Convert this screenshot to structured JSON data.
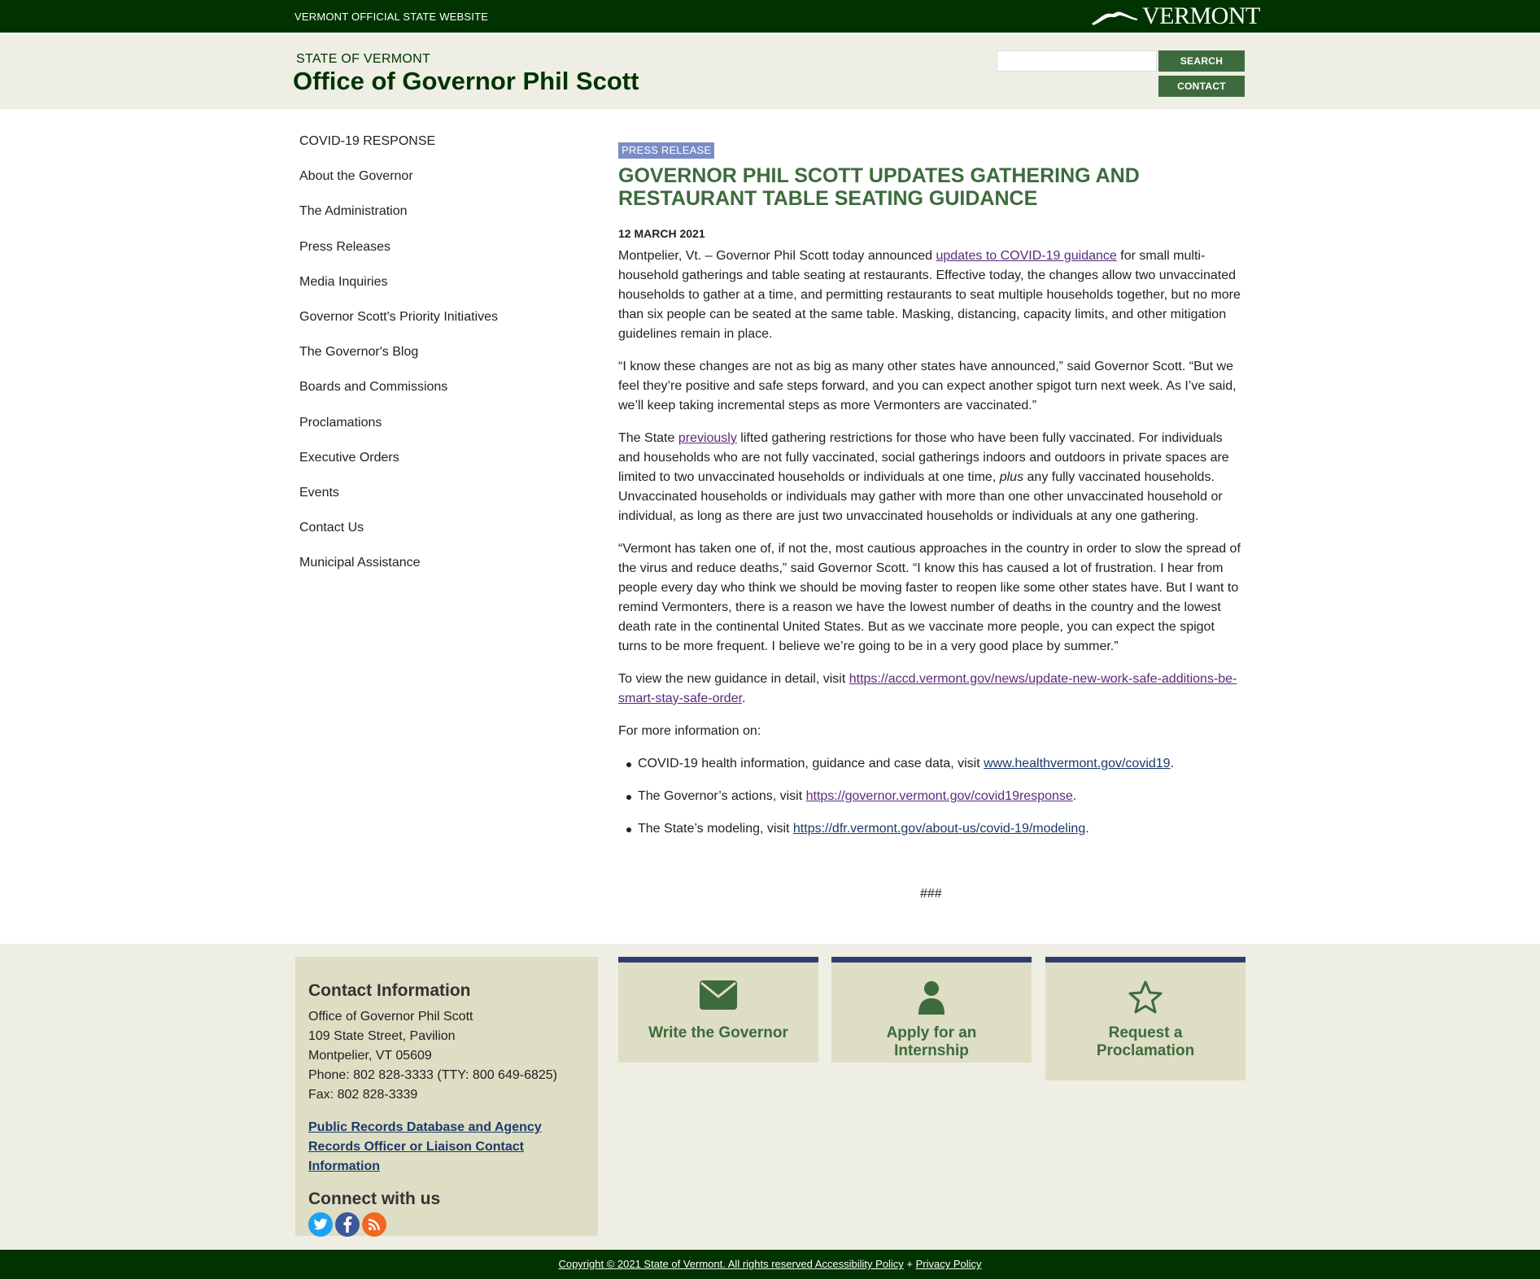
{
  "topbar": {
    "official_label": "VERMONT OFFICIAL STATE WEBSITE",
    "logo_text": "VERMONT"
  },
  "header": {
    "state_label": "STATE OF VERMONT",
    "office_title": "Office of Governor Phil Scott",
    "search_placeholder": "",
    "search_button": "SEARCH",
    "contact_button": "CONTACT"
  },
  "sidebar": {
    "items": [
      "COVID-19 RESPONSE",
      "About the Governor",
      "The Administration",
      "Press Releases",
      "Media Inquiries",
      "Governor Scott's Priority Initiatives",
      "The Governor's Blog",
      "Boards and Commissions",
      "Proclamations",
      "Executive Orders",
      "Events",
      "Contact Us",
      "Municipal Assistance"
    ]
  },
  "article": {
    "badge": "PRESS RELEASE",
    "headline": "GOVERNOR PHIL SCOTT UPDATES GATHERING AND RESTAURANT TABLE SEATING GUIDANCE",
    "date": "12 MARCH 2021",
    "p1_before": "Montpelier, Vt. – Governor Phil Scott today announced ",
    "p1_link": "updates to COVID-19 guidance",
    "p1_after": " for small multi-household gatherings and table seating at restaurants. Effective today, the changes allow two unvaccinated households to gather at a time, and permitting restaurants to seat multiple households together, but no more than six people can be seated at the same table. Masking, distancing, capacity limits, and other mitigation guidelines remain in place.",
    "p2": "“I know these changes are not as big as many other states have announced,” said Governor Scott. “But we feel they’re positive and safe steps forward, and you can expect another spigot turn next week. As I’ve said, we’ll keep taking incremental steps as more Vermonters are vaccinated.”",
    "p3_before": "The State ",
    "p3_link": "previously",
    "p3_mid": " lifted gathering restrictions for those who have been fully vaccinated. For individuals and households who are not fully vaccinated, social gatherings indoors and outdoors in private spaces are limited to two unvaccinated households or individuals at one time, ",
    "p3_em": "plus",
    "p3_after": " any fully vaccinated households. Unvaccinated households or individuals may gather with more than one other unvaccinated household or individual, as long as there are just two unvaccinated households or individuals at any one gathering.",
    "p4": "“Vermont has taken one of, if not the, most cautious approaches in the country in order to slow the spread of the virus and reduce deaths,” said Governor Scott. “I know this has caused a lot of frustration. I hear from people every day who think we should be moving faster to reopen like some other states have. But I want to remind Vermonters, there is a reason we have the lowest number of deaths in the country and the lowest death rate in the continental United States. But as we vaccinate more people, you can expect the spigot turns to be more frequent. I believe we’re going to be in a very good place by summer.”",
    "p5_before": "To view the new guidance in detail, visit ",
    "p5_link": "https://accd.vermont.gov/news/update-new-work-safe-additions-be-smart-stay-safe-order",
    "p5_after": ".",
    "p6": "For more information on:",
    "bullets": [
      {
        "before": "COVID-19 health information, guidance and case data, visit ",
        "link": "www.healthvermont.gov/covid19",
        "after": "."
      },
      {
        "before": "The Governor’s actions, visit ",
        "link": "https://governor.vermont.gov/covid19response",
        "after": "."
      },
      {
        "before": "The State’s modeling, visit ",
        "link": "https://dfr.vermont.gov/about-us/covid-19/modeling",
        "after": "."
      }
    ],
    "end_mark": "###"
  },
  "footer": {
    "contact_title": "Contact Information",
    "lines": [
      "Office of Governor Phil Scott",
      "109 State Street, Pavilion",
      "Montpelier, VT 05609",
      "Phone: 802 828-3333 (TTY: 800 649-6825)",
      "Fax: 802 828-3339"
    ],
    "records_link": "Public Records Database and Agency Records Officer or Liaison Contact Information",
    "connect_title": "Connect with us",
    "social_icons": [
      "twitter-icon",
      "facebook-icon",
      "rss-icon"
    ],
    "cards": [
      {
        "label": "Write the Governor",
        "icon": "envelope-icon"
      },
      {
        "label": "Apply for an Internship",
        "icon": "person-icon"
      },
      {
        "label": "Request a Proclamation",
        "icon": "star-icon"
      }
    ]
  },
  "bottombar": {
    "copyright": "Copyright © 2021 State of Vermont. All rights reserved ",
    "accessibility": "Accessibility Policy",
    "plus": " + ",
    "privacy": "Privacy Policy"
  },
  "colors": {
    "dark_green": "#003300",
    "accent_green": "#3d6b3d",
    "beige": "#eeeee4",
    "card_bg": "#dedec4",
    "card_border": "#2e3f6e",
    "badge_bg": "#7a8cc7",
    "link_purple": "#5b2a7a",
    "link_blue": "#1a3a6a"
  }
}
